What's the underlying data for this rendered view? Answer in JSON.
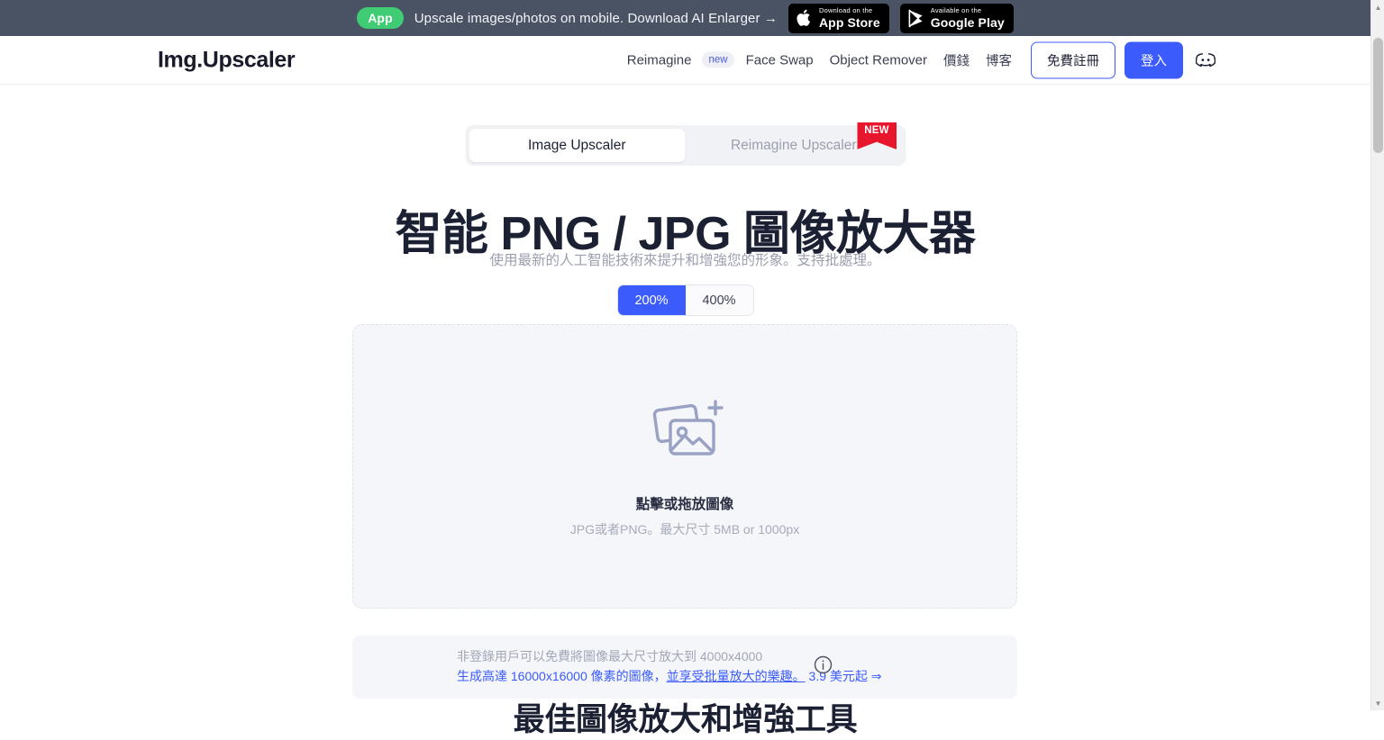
{
  "promo": {
    "pill": "App",
    "text": "Upscale images/photos on mobile. Download AI Enlarger →",
    "app_store": {
      "small": "Download on the",
      "big": "App Store",
      "icon": "apple-icon"
    },
    "google_play": {
      "small": "Available on the",
      "big": "Google Play",
      "icon": "google-play-icon"
    }
  },
  "header": {
    "brand": "Img.Upscaler",
    "nav": [
      {
        "label": "Reimagine",
        "badge": "new"
      },
      {
        "label": "Face Swap"
      },
      {
        "label": "Object Remover"
      },
      {
        "label": "價錢"
      },
      {
        "label": "博客"
      }
    ],
    "signup_label": "免費註冊",
    "login_label": "登入",
    "discord_icon": "discord-icon"
  },
  "tabs": {
    "items": [
      {
        "label": "Image Upscaler",
        "active": true
      },
      {
        "label": "Reimagine Upscaler",
        "active": false,
        "badge": "NEW"
      }
    ]
  },
  "hero": {
    "title": "智能 PNG / JPG 圖像放大器",
    "subtitle": "使用最新的人工智能技術來提升和增強您的形象。支持批處理。"
  },
  "scale": {
    "options": [
      {
        "label": "200%",
        "selected": true
      },
      {
        "label": "400%",
        "selected": false
      }
    ]
  },
  "dropzone": {
    "icon": "add-image-icon",
    "title": "點擊或拖放圖像",
    "subtitle": "JPG或者PNG。最大尺寸 5MB or 1000px"
  },
  "info": {
    "icon": "info-circle-icon",
    "line1": "非登錄用戶可以免費將圖像最大尺寸放大到 4000x4000",
    "line2_a": "生成高達 16000x16000 像素的圖像，",
    "line2_b": "並享受批量放大的樂趣。",
    "line2_c": " 3.9 美元起 ⇒"
  },
  "section": {
    "title": "最佳圖像放大和增強工具"
  },
  "scrollbar": {
    "up_icon": "chevron-up-icon",
    "down_icon": "chevron-down-icon"
  },
  "colors": {
    "banner_bg": "#4a5364",
    "accent_blue": "#3b5bfd",
    "badge_green": "#3fcc74",
    "ribbon_red": "#e8162c",
    "surface": "#f5f6fa"
  }
}
